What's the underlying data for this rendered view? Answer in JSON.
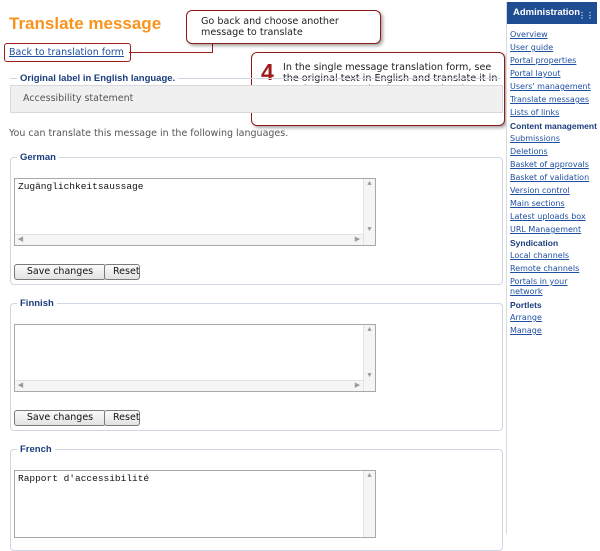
{
  "page": {
    "title": "Translate message",
    "back_link": "Back to translation form",
    "original_legend": "Original label in English language.",
    "original_text": "Accessibility statement",
    "info_text": "You can translate this message in the following languages."
  },
  "callouts": [
    {
      "text": "Go back and choose another message to translate"
    },
    {
      "number": "4",
      "text": "In the single message translation form, see the original text in English and translate it in one language at the time. Save the changes after each translation"
    }
  ],
  "languages": [
    {
      "name": "German",
      "value": "Zugänglichkeitsaussage",
      "save_label": "Save changes",
      "reset_label": "Reset"
    },
    {
      "name": "Finnish",
      "value": "",
      "save_label": "Save changes",
      "reset_label": "Reset"
    },
    {
      "name": "French",
      "value": "Rapport d'accessibilité",
      "save_label": "Save changes",
      "reset_label": "Reset"
    }
  ],
  "sidebar": {
    "header": "Administration",
    "entries": [
      {
        "type": "link",
        "label": "Overview"
      },
      {
        "type": "link",
        "label": "User guide"
      },
      {
        "type": "link",
        "label": "Portal properties"
      },
      {
        "type": "link",
        "label": "Portal layout"
      },
      {
        "type": "link",
        "label": "Users' management"
      },
      {
        "type": "link",
        "label": "Translate messages"
      },
      {
        "type": "link",
        "label": "Lists of links"
      },
      {
        "type": "section",
        "label": "Content management"
      },
      {
        "type": "link",
        "label": "Submissions"
      },
      {
        "type": "link",
        "label": "Deletions"
      },
      {
        "type": "link",
        "label": "Basket of approvals"
      },
      {
        "type": "link",
        "label": "Basket of validation"
      },
      {
        "type": "link",
        "label": "Version control"
      },
      {
        "type": "link",
        "label": "Main sections"
      },
      {
        "type": "link",
        "label": "Latest uploads box"
      },
      {
        "type": "link",
        "label": "URL Management"
      },
      {
        "type": "section",
        "label": "Syndication"
      },
      {
        "type": "link",
        "label": "Local channels"
      },
      {
        "type": "link",
        "label": "Remote channels"
      },
      {
        "type": "link",
        "label": "Portals in your network"
      },
      {
        "type": "section",
        "label": "Portlets"
      },
      {
        "type": "link",
        "label": "Arrange"
      },
      {
        "type": "link",
        "label": "Manage"
      }
    ]
  },
  "colors": {
    "title": "#f7941d",
    "link": "#1f4fa0",
    "sidebar_header": "#1f4d93",
    "callout_border": "#a01c1c"
  }
}
